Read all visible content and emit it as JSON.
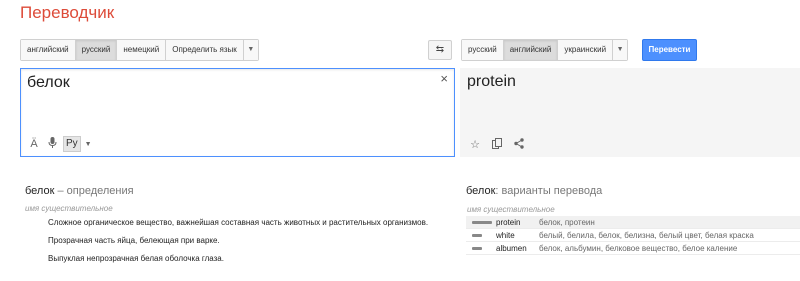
{
  "app": {
    "title": "Переводчик"
  },
  "source_langs": [
    {
      "label": "английский",
      "selected": false
    },
    {
      "label": "русский",
      "selected": true
    },
    {
      "label": "немецкий",
      "selected": false
    },
    {
      "label": "Определить язык",
      "selected": false
    }
  ],
  "target_langs": [
    {
      "label": "русский",
      "selected": false
    },
    {
      "label": "английский",
      "selected": true
    },
    {
      "label": "украинский",
      "selected": false
    }
  ],
  "translate_button": "Перевести",
  "source": {
    "text": "белок",
    "keyboard": "Ру"
  },
  "result": {
    "text": "protein"
  },
  "definitions": {
    "word": "белок",
    "suffix": " – определения",
    "part_of_speech": "имя существительное",
    "items": [
      "Сложное органическое вещество, важнейшая составная часть животных и растительных организмов.",
      "Прозрачная часть яйца, белеющая при варке.",
      "Выпуклая непрозрачная белая оболочка глаза."
    ]
  },
  "translations": {
    "word": "белок",
    "suffix": ": варианты перевода",
    "part_of_speech": "имя существительное",
    "rows": [
      {
        "word": "protein",
        "synonyms": "белок, протеин",
        "frequency": 1.0
      },
      {
        "word": "white",
        "synonyms": "белый, белила, белок, белизна, белый цвет, белая краска",
        "frequency": 0.5
      },
      {
        "word": "albumen",
        "synonyms": "белок, альбумин, белковое вещество, белое каление",
        "frequency": 0.5
      }
    ]
  },
  "icons": {
    "swap": "swap-languages-icon",
    "clear": "close-icon",
    "listen": "speaker-icon",
    "mic": "microphone-icon",
    "star": "star-icon",
    "copy": "copy-icon",
    "share": "share-icon"
  },
  "colors": {
    "accent": "#4d90fe",
    "title": "#dd4b39"
  }
}
